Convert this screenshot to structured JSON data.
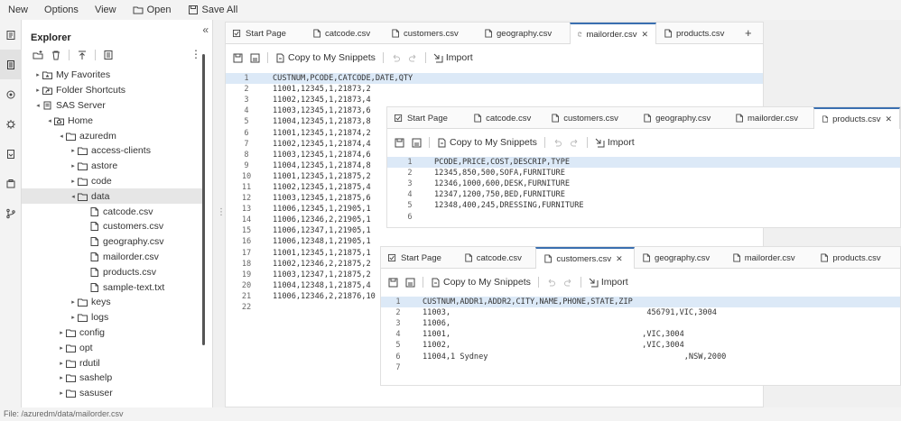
{
  "menu": {
    "new": "New",
    "options": "Options",
    "view": "View",
    "open": "Open",
    "save_all": "Save All"
  },
  "explorer": {
    "title": "Explorer",
    "collapse": "«",
    "more": "⋮",
    "tree": [
      {
        "label": "My Favorites",
        "depth": 0,
        "twisty": "▸",
        "icon": "star-folder-icon"
      },
      {
        "label": "Folder Shortcuts",
        "depth": 0,
        "twisty": "▸",
        "icon": "shortcut-folder-icon"
      },
      {
        "label": "SAS Server",
        "depth": 0,
        "twisty": "◂",
        "icon": "server-icon"
      },
      {
        "label": "Home",
        "depth": 1,
        "twisty": "◂",
        "icon": "home-folder-icon"
      },
      {
        "label": "azuredm",
        "depth": 2,
        "twisty": "◂",
        "icon": "folder-icon"
      },
      {
        "label": "access-clients",
        "depth": 3,
        "twisty": "▸",
        "icon": "folder-icon"
      },
      {
        "label": "astore",
        "depth": 3,
        "twisty": "▸",
        "icon": "folder-icon"
      },
      {
        "label": "code",
        "depth": 3,
        "twisty": "▸",
        "icon": "folder-icon"
      },
      {
        "label": "data",
        "depth": 3,
        "twisty": "◂",
        "icon": "folder-icon",
        "selected": true
      },
      {
        "label": "catcode.csv",
        "depth": 4,
        "twisty": "",
        "icon": "file-icon"
      },
      {
        "label": "customers.csv",
        "depth": 4,
        "twisty": "",
        "icon": "file-icon"
      },
      {
        "label": "geography.csv",
        "depth": 4,
        "twisty": "",
        "icon": "file-icon"
      },
      {
        "label": "mailorder.csv",
        "depth": 4,
        "twisty": "",
        "icon": "file-icon"
      },
      {
        "label": "products.csv",
        "depth": 4,
        "twisty": "",
        "icon": "file-icon"
      },
      {
        "label": "sample-text.txt",
        "depth": 4,
        "twisty": "",
        "icon": "file-icon"
      },
      {
        "label": "keys",
        "depth": 3,
        "twisty": "▸",
        "icon": "folder-icon"
      },
      {
        "label": "logs",
        "depth": 3,
        "twisty": "▸",
        "icon": "folder-icon"
      },
      {
        "label": "config",
        "depth": 2,
        "twisty": "▸",
        "icon": "folder-icon"
      },
      {
        "label": "opt",
        "depth": 2,
        "twisty": "▸",
        "icon": "folder-icon"
      },
      {
        "label": "rdutil",
        "depth": 2,
        "twisty": "▸",
        "icon": "folder-icon"
      },
      {
        "label": "sashelp",
        "depth": 2,
        "twisty": "▸",
        "icon": "folder-icon"
      },
      {
        "label": "sasuser",
        "depth": 2,
        "twisty": "▸",
        "icon": "folder-icon"
      }
    ]
  },
  "status": "File: /azuredm/data/mailorder.csv",
  "editor_toolbar": {
    "copy_snippets": "Copy to My Snippets",
    "import": "Import"
  },
  "editors": [
    {
      "id": "mailorder",
      "tabs": [
        {
          "label": "Start Page",
          "icon": "start-page-icon"
        },
        {
          "label": "catcode.csv",
          "icon": "file-icon"
        },
        {
          "label": "customers.csv",
          "icon": "file-icon"
        },
        {
          "label": "geography.csv",
          "icon": "file-icon"
        },
        {
          "label": "mailorder.csv",
          "icon": "file-icon",
          "active": true
        },
        {
          "label": "products.csv",
          "icon": "file-icon"
        }
      ],
      "add_tab": "+",
      "lines": [
        "CUSTNUM,PCODE,CATCODE,DATE,QTY",
        "11001,12345,1,21873,2",
        "11002,12345,1,21873,4",
        "11003,12345,1,21873,6",
        "11004,12345,1,21873,8",
        "11001,12345,1,21874,2",
        "11002,12345,1,21874,4",
        "11003,12345,1,21874,6",
        "11004,12345,1,21874,8",
        "11001,12345,1,21875,2",
        "11002,12345,1,21875,4",
        "11003,12345,1,21875,6",
        "11006,12345,1,21905,1",
        "11006,12346,2,21905,1",
        "11006,12347,1,21905,1",
        "11006,12348,1,21905,1",
        "11001,12345,1,21875,1",
        "11002,12346,2,21875,2",
        "11003,12347,1,21875,2",
        "11004,12348,1,21875,4",
        "11006,12346,2,21876,10",
        ""
      ]
    },
    {
      "id": "products",
      "tabs": [
        {
          "label": "Start Page",
          "icon": "start-page-icon"
        },
        {
          "label": "catcode.csv",
          "icon": "file-icon"
        },
        {
          "label": "customers.csv",
          "icon": "file-icon"
        },
        {
          "label": "geography.csv",
          "icon": "file-icon"
        },
        {
          "label": "mailorder.csv",
          "icon": "file-icon"
        },
        {
          "label": "products.csv",
          "icon": "file-icon",
          "active": true
        }
      ],
      "lines": [
        "PCODE,PRICE,COST,DESCRIP,TYPE",
        "12345,850,500,SOFA,FURNITURE",
        "12346,1000,600,DESK,FURNITURE",
        "12347,1200,750,BED,FURNITURE",
        "12348,400,245,DRESSING,FURNITURE",
        ""
      ]
    },
    {
      "id": "customers",
      "tabs": [
        {
          "label": "Start Page",
          "icon": "start-page-icon"
        },
        {
          "label": "catcode.csv",
          "icon": "file-icon"
        },
        {
          "label": "customers.csv",
          "icon": "file-icon",
          "active": true
        },
        {
          "label": "geography.csv",
          "icon": "file-icon"
        },
        {
          "label": "mailorder.csv",
          "icon": "file-icon"
        },
        {
          "label": "products.csv",
          "icon": "file-icon"
        }
      ],
      "lines": [
        "CUSTNUM,ADDR1,ADDR2,CITY,NAME,PHONE,STATE,ZIP",
        "11003,                                          456791,VIC,3004",
        "11006,",
        "11001,                                         ,VIC,3004",
        "11002,                                         ,VIC,3004",
        "11004,1 Sydney                                          ,NSW,2000",
        ""
      ]
    }
  ]
}
